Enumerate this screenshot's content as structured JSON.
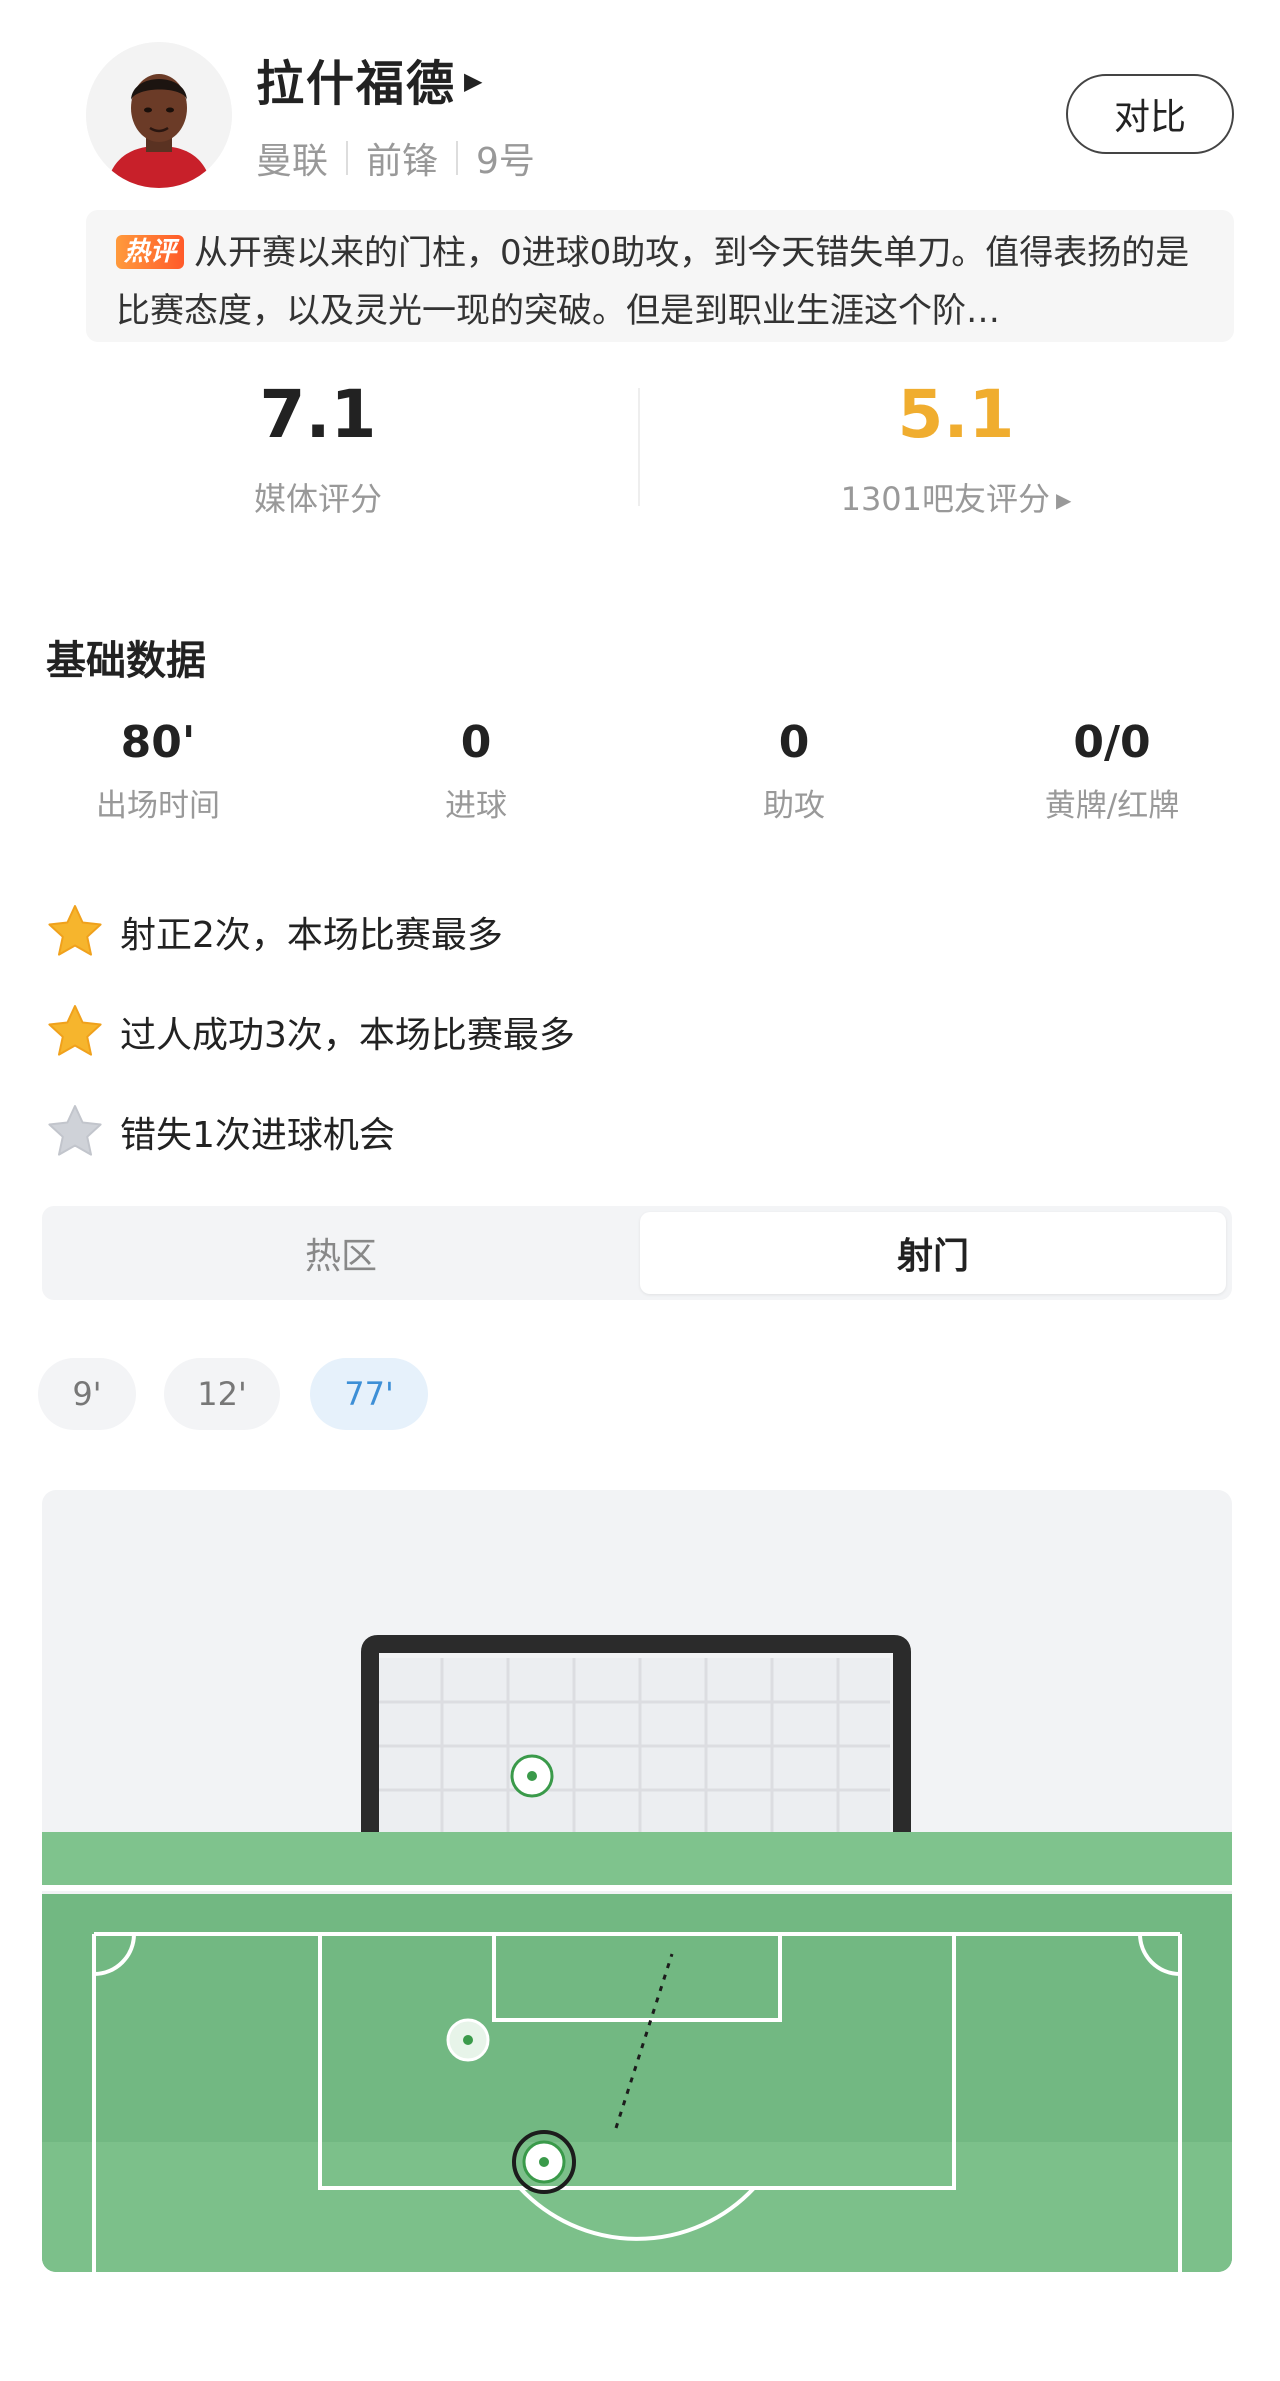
{
  "player": {
    "name": "拉什福德",
    "team": "曼联",
    "position": "前锋",
    "number": "9号",
    "compare_label": "对比"
  },
  "comment": {
    "tag": "热评",
    "text": "从开赛以来的门柱，0进球0助攻，到今天错失单刀。值得表扬的是比赛态度，以及灵光一现的突破。但是到职业生涯这个阶…"
  },
  "ratings": {
    "media_value": "7.1",
    "media_label": "媒体评分",
    "fan_value": "5.1",
    "fan_label": "1301吧友评分",
    "fan_color": "#f0ad2f"
  },
  "basic_stats": {
    "title": "基础数据",
    "items": [
      {
        "value": "80'",
        "label": "出场时间"
      },
      {
        "value": "0",
        "label": "进球"
      },
      {
        "value": "0",
        "label": "助攻"
      },
      {
        "value": "0/0",
        "label": "黄牌/红牌"
      }
    ]
  },
  "highlights": [
    {
      "text": "射正2次，本场比赛最多",
      "icon": "gold-star-icon"
    },
    {
      "text": "过人成功3次，本场比赛最多",
      "icon": "gold-star-icon"
    },
    {
      "text": "错失1次进球机会",
      "icon": "grey-star-icon"
    }
  ],
  "tabs": [
    {
      "label": "热区",
      "active": false
    },
    {
      "label": "射门",
      "active": true
    }
  ],
  "shot_minutes": [
    {
      "label": "9'",
      "active": false
    },
    {
      "label": "12'",
      "active": false
    },
    {
      "label": "77'",
      "active": true
    }
  ],
  "colors": {
    "pitch_green": "#7cc08a",
    "shot_marker": "#3a9a4a",
    "active_chip": "#3d8fd6"
  }
}
